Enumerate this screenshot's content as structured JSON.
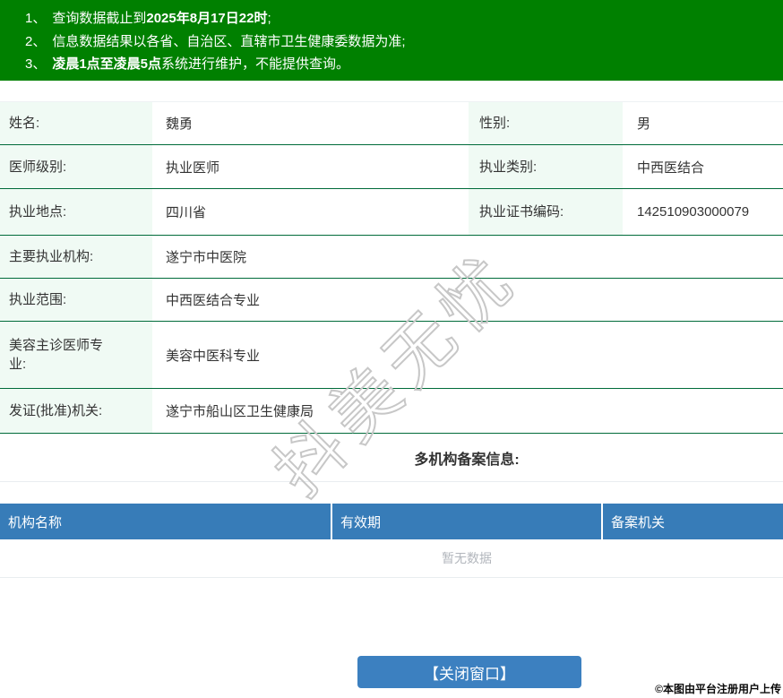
{
  "banner": {
    "bg_color": "#008000",
    "notices": [
      {
        "num": "1、",
        "segments": [
          {
            "text": "查询数据截止到",
            "bold": false
          },
          {
            "text": "2025年8月17日22时",
            "bold": true
          },
          {
            "text": ";",
            "bold": false
          }
        ]
      },
      {
        "num": "2、",
        "segments": [
          {
            "text": "信息数据结果以各省、自治区、直辖市卫生健康委数据为准;",
            "bold": false
          }
        ]
      },
      {
        "num": "3、",
        "segments": [
          {
            "text": "凌晨1点至凌晨5点",
            "bold": true
          },
          {
            "text": "系统进行维护，不能提供查询。",
            "bold": false
          }
        ]
      }
    ]
  },
  "info": {
    "rows": [
      {
        "label": "姓名:",
        "value": "魏勇",
        "label2": "性别:",
        "value2": "男"
      },
      {
        "label": "医师级别:",
        "value": "执业医师",
        "label2": "执业类别:",
        "value2": "中西医结合"
      },
      {
        "label": "执业地点:",
        "value": "四川省",
        "label2": "执业证书编码:",
        "value2": "142510903000079"
      },
      {
        "label": "主要执业机构:",
        "value": "遂宁市中医院"
      },
      {
        "label": "执业范围:",
        "value": "中西医结合专业"
      },
      {
        "label": "美容主诊医师专业:",
        "value": "美容中医科专业"
      },
      {
        "label": "发证(批准)机关:",
        "value": "遂宁市船山区卫生健康局"
      }
    ]
  },
  "section": {
    "title": "多机构备案信息:"
  },
  "records_table": {
    "headers": [
      "机构名称",
      "有效期",
      "备案机关"
    ],
    "empty_text": "暂无数据",
    "header_bg": "#377cb8"
  },
  "footer": {
    "close_button_label": "【关闭窗口】",
    "uploader_note": "©本图由平台注册用户上传"
  },
  "watermark": {
    "text": "抖美无忧"
  },
  "colors": {
    "banner_green": "#008000",
    "row_border_green": "#006b3a",
    "label_cell_bg": "#f0faf4",
    "table_header_blue": "#377cb8",
    "button_blue": "#3c80c0",
    "empty_text_gray": "#b2b6bc"
  }
}
